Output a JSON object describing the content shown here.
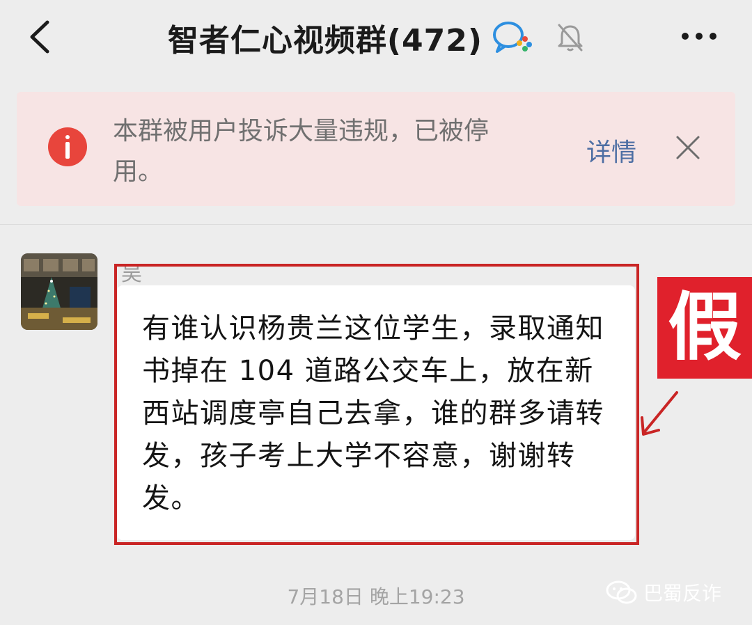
{
  "header": {
    "title": "智者仁心视频群(472)",
    "back_icon": "chevron-left-icon",
    "wecom_icon": "wecom-chat-icon",
    "mute_icon": "bell-off-icon",
    "more_icon": "ellipsis-icon"
  },
  "notice": {
    "text": "本群被用户投诉大量违规，已被停用。",
    "details_label": "详情",
    "info_icon": "info-icon",
    "close_icon": "close-icon",
    "accent_color": "#e8453c",
    "background_color": "#f7e4e4"
  },
  "message": {
    "sender": "吴",
    "text": "有谁认识杨贵兰这位学生，录取通知书掉在 104 道路公交车上，放在新西站调度亭自己去拿，谁的群多请转发，孩子考上大学不容意，谢谢转发。",
    "avatar": "avatar-photo"
  },
  "annotation": {
    "label": "假",
    "color": "#e0212c",
    "arrow_icon": "arrow-pointer-icon"
  },
  "timestamp": "7月18日 晚上19:23",
  "watermark": {
    "text": "巴蜀反诈",
    "icon": "wechat-icon"
  }
}
